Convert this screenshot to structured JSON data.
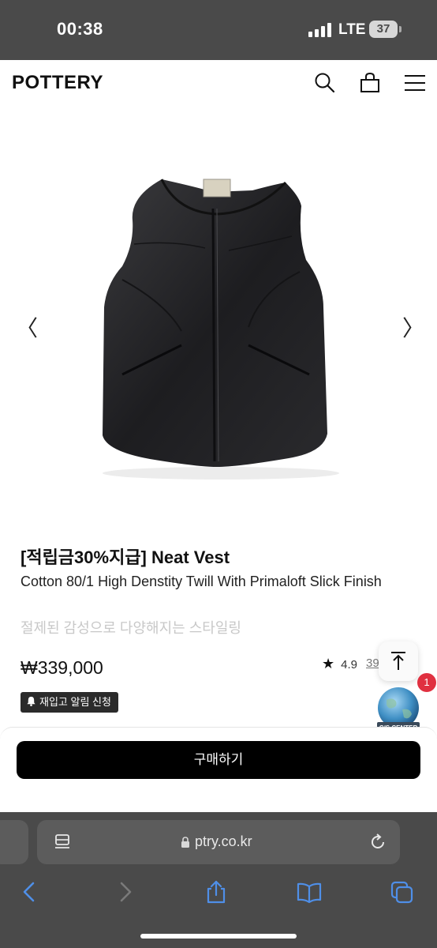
{
  "status": {
    "time": "00:38",
    "network": "LTE",
    "battery": "37"
  },
  "header": {
    "logo": "POTTERY"
  },
  "gallery": {
    "prev": "〈",
    "next": "〉"
  },
  "product": {
    "title": "[적립금30%지급] Neat Vest",
    "description": "Cotton 80/1 High Denstity Twill With Primaloft Slick Finish",
    "tagline": "절제된 감성으로 다양해지는 스타일링",
    "price": "₩339,000",
    "rating": "4.9",
    "reviews": "39",
    "restock": "재입고 알림 신청"
  },
  "cs": {
    "label": "C/S CENTER",
    "badge": "1"
  },
  "buy": {
    "label": "구매하기"
  },
  "browser": {
    "url": "ptry.co.kr"
  },
  "colors": {
    "status_bg": "#4a4a4a",
    "accent_blue": "#4f8fe8",
    "buy_bg": "#000000",
    "badge_red": "#e03040"
  }
}
